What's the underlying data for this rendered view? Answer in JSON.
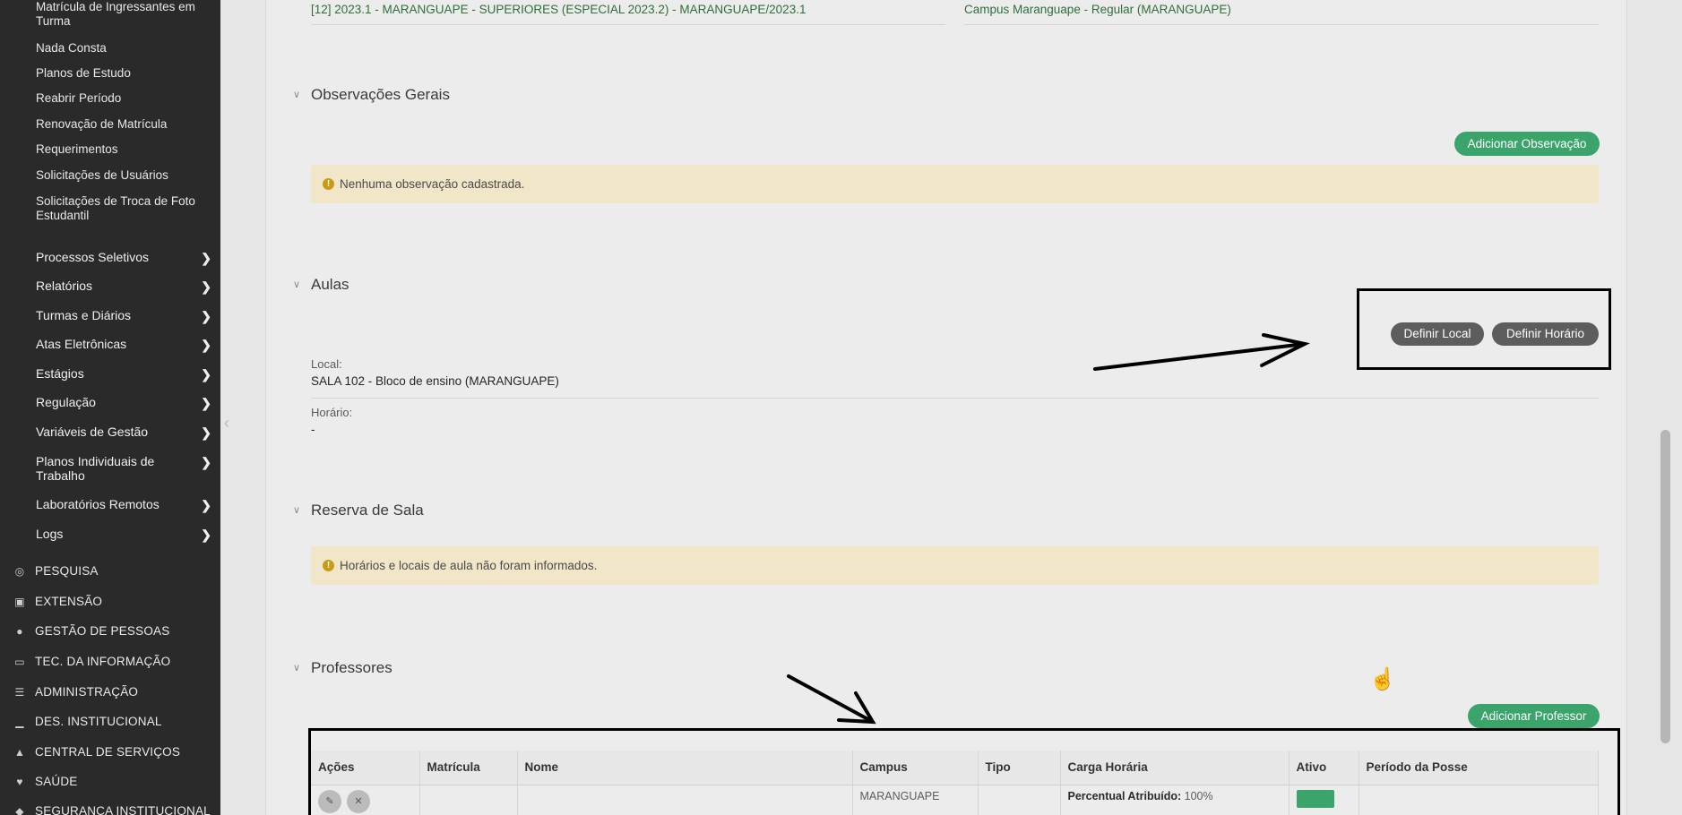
{
  "sidebar": {
    "sub_items": [
      "Matrícula de Ingressantes em Turma",
      "Nada Consta",
      "Planos de Estudo",
      "Reabrir Período",
      "Renovação de Matrícula",
      "Requerimentos",
      "Solicitações de Usuários",
      "Solicitações de Troca de Foto Estudantil"
    ],
    "menu_items": [
      "Processos Seletivos",
      "Relatórios",
      "Turmas e Diários",
      "Atas Eletrônicas",
      "Estágios",
      "Regulação",
      "Variáveis de Gestão",
      "Planos Individuais de Trabalho",
      "Laboratórios Remotos",
      "Logs"
    ],
    "sections": [
      {
        "label": "PESQUISA",
        "icon": "globe-icon"
      },
      {
        "label": "EXTENSÃO",
        "icon": "building-icon"
      },
      {
        "label": "GESTÃO DE PESSOAS",
        "icon": "users-icon"
      },
      {
        "label": "TEC. DA INFORMAÇÃO",
        "icon": "laptop-icon"
      },
      {
        "label": "ADMINISTRAÇÃO",
        "icon": "list-icon"
      },
      {
        "label": "DES. INSTITUCIONAL",
        "icon": "chart-icon"
      },
      {
        "label": "CENTRAL DE SERVIÇOS",
        "icon": "cloud-icon"
      },
      {
        "label": "SAÚDE",
        "icon": "heart-icon"
      },
      {
        "label": "SEGURANÇA INSTITUCIONAL",
        "icon": "shield-icon"
      }
    ]
  },
  "top": {
    "turma_link": "[12] 2023.1 - MARANGUAPE - SUPERIORES (ESPECIAL 2023.2) - MARANGUAPE/2023.1",
    "campus_link": "Campus Maranguape - Regular (MARANGUAPE)"
  },
  "observacoes": {
    "title": "Observações Gerais",
    "add_button": "Adicionar Observação",
    "alert": "Nenhuma observação cadastrada."
  },
  "aulas": {
    "title": "Aulas",
    "definir_local": "Definir Local",
    "definir_horario": "Definir Horário",
    "local_label": "Local:",
    "local_value": "SALA 102 - Bloco de ensino (MARANGUAPE)",
    "horario_label": "Horário:",
    "horario_value": "-"
  },
  "reserva": {
    "title": "Reserva de Sala",
    "alert": "Horários e locais de aula não foram informados."
  },
  "professores": {
    "title": "Professores",
    "add_button": "Adicionar Professor",
    "columns": [
      "Ações",
      "Matrícula",
      "Nome",
      "Campus",
      "Tipo",
      "Carga Horária",
      "Ativo",
      "Período da Posse"
    ],
    "row": {
      "campus": "MARANGUAPE",
      "carga_label": "Percentual Atribuído:",
      "carga_value": "100%"
    }
  },
  "colors": {
    "accent_green": "#3aa46a",
    "sidebar_bg": "#2a2a2a",
    "alert_bg": "#f2e6c8"
  }
}
